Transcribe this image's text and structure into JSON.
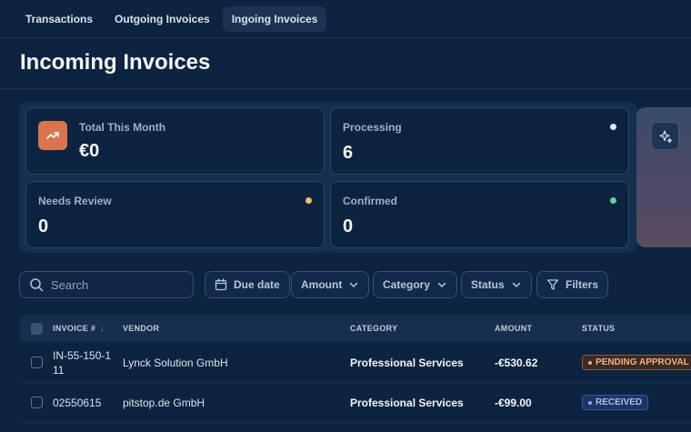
{
  "tabs": [
    {
      "label": "Transactions",
      "active": false
    },
    {
      "label": "Outgoing Invoices",
      "active": false
    },
    {
      "label": "Ingoing Invoices",
      "active": true
    }
  ],
  "page": {
    "title": "Incoming Invoices"
  },
  "stats": {
    "total": {
      "label": "Total This Month",
      "value": "€0",
      "icon": "trending-up-icon"
    },
    "processing": {
      "label": "Processing",
      "value": "6",
      "dot_color": "#dfe6ee"
    },
    "needs_review": {
      "label": "Needs Review",
      "value": "0",
      "dot_color": "#f0c066"
    },
    "confirmed": {
      "label": "Confirmed",
      "value": "0",
      "dot_color": "#5fd3a6"
    }
  },
  "ai": {
    "icon": "sparkle-icon"
  },
  "search": {
    "placeholder": "Search",
    "value": ""
  },
  "filters": {
    "due_date": "Due date",
    "amount": "Amount",
    "category": "Category",
    "status": "Status",
    "more": "Filters"
  },
  "table": {
    "columns": {
      "invoice": "INVOICE #",
      "vendor": "VENDOR",
      "category": "CATEGORY",
      "amount": "AMOUNT",
      "status": "STATUS"
    },
    "rows": [
      {
        "invoice": "IN-55-150-1 11",
        "vendor": "Lynck Solution GmbH",
        "category": "Professional Services",
        "amount": "-€530.62",
        "status": "PENDING APPROVAL"
      },
      {
        "invoice": "02550615",
        "vendor": "pitstop.de GmbH",
        "category": "Professional Services",
        "amount": "-€99.00",
        "status": "RECEIVED"
      }
    ]
  },
  "colors": {
    "background": "#0d2440",
    "accent_orange": "#d8754f",
    "pending": "#f1b27e",
    "received": "#a9bff2"
  }
}
